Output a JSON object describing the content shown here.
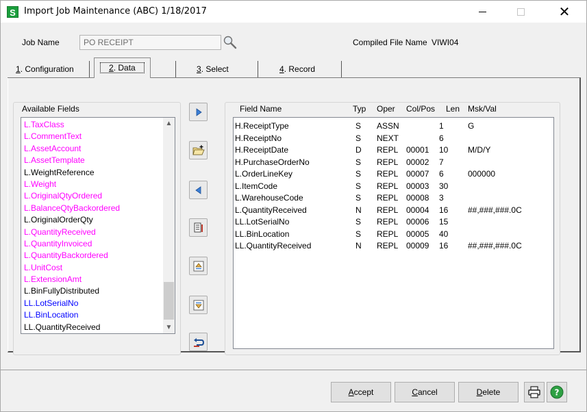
{
  "window": {
    "title": "Import Job Maintenance (ABC) 1/18/2017",
    "app_icon_letter": "S"
  },
  "header": {
    "job_name_label": "Job Name",
    "job_name_value": "PO RECEIPT",
    "compiled_label": "Compiled File Name",
    "compiled_value": "VIWI04"
  },
  "tabs": [
    {
      "num": "1",
      "label": ". Configuration"
    },
    {
      "num": "2",
      "label": ". Data"
    },
    {
      "num": "3",
      "label": ". Select"
    },
    {
      "num": "4",
      "label": ". Record"
    }
  ],
  "available_fields": {
    "title": "Available Fields",
    "items": [
      {
        "label": "L.TaxClass",
        "color": "#ff00ff"
      },
      {
        "label": "L.CommentText",
        "color": "#ff00ff"
      },
      {
        "label": "L.AssetAccount",
        "color": "#ff00ff"
      },
      {
        "label": "L.AssetTemplate",
        "color": "#ff00ff"
      },
      {
        "label": "L.WeightReference",
        "color": "#000000"
      },
      {
        "label": "L.Weight",
        "color": "#ff00ff"
      },
      {
        "label": "L.OriginalQtyOrdered",
        "color": "#ff00ff"
      },
      {
        "label": "L.BalanceQtyBackordered",
        "color": "#ff00ff"
      },
      {
        "label": "L.OriginalOrderQty",
        "color": "#000000"
      },
      {
        "label": "L.QuantityReceived",
        "color": "#ff00ff"
      },
      {
        "label": "L.QuantityInvoiced",
        "color": "#ff00ff"
      },
      {
        "label": "L.QuantityBackordered",
        "color": "#ff00ff"
      },
      {
        "label": "L.UnitCost",
        "color": "#ff00ff"
      },
      {
        "label": "L.ExtensionAmt",
        "color": "#ff00ff"
      },
      {
        "label": "L.BinFullyDistributed",
        "color": "#000000"
      },
      {
        "label": "LL.LotSerialNo",
        "color": "#0000ff"
      },
      {
        "label": "LL.BinLocation",
        "color": "#0000ff"
      },
      {
        "label": "LL.QuantityReceived",
        "color": "#000000"
      }
    ]
  },
  "field_table": {
    "headers": {
      "name": "Field Name",
      "typ": "Typ",
      "oper": "Oper",
      "colpos": "Col/Pos",
      "len": "Len",
      "msk": "Msk/Val"
    },
    "rows": [
      {
        "name": "H.ReceiptType",
        "typ": "S",
        "oper": "ASSN",
        "colpos": "",
        "len": "1",
        "msk": "G"
      },
      {
        "name": "H.ReceiptNo",
        "typ": "S",
        "oper": "NEXT",
        "colpos": "",
        "len": "6",
        "msk": ""
      },
      {
        "name": "H.ReceiptDate",
        "typ": "D",
        "oper": "REPL",
        "colpos": "00001",
        "len": "10",
        "msk": "M/D/Y"
      },
      {
        "name": "H.PurchaseOrderNo",
        "typ": "S",
        "oper": "REPL",
        "colpos": "00002",
        "len": "7",
        "msk": ""
      },
      {
        "name": "L.OrderLineKey",
        "typ": "S",
        "oper": "REPL",
        "colpos": "00007",
        "len": "6",
        "msk": "000000"
      },
      {
        "name": "L.ItemCode",
        "typ": "S",
        "oper": "REPL",
        "colpos": "00003",
        "len": "30",
        "msk": ""
      },
      {
        "name": "L.WarehouseCode",
        "typ": "S",
        "oper": "REPL",
        "colpos": "00008",
        "len": "3",
        "msk": ""
      },
      {
        "name": "L.QuantityReceived",
        "typ": "N",
        "oper": "REPL",
        "colpos": "00004",
        "len": "16",
        "msk": "##,###,###.0C"
      },
      {
        "name": "LL.LotSerialNo",
        "typ": "S",
        "oper": "REPL",
        "colpos": "00006",
        "len": "15",
        "msk": ""
      },
      {
        "name": "LL.BinLocation",
        "typ": "S",
        "oper": "REPL",
        "colpos": "00005",
        "len": "40",
        "msk": ""
      },
      {
        "name": "LL.QuantityReceived",
        "typ": "N",
        "oper": "REPL",
        "colpos": "00009",
        "len": "16",
        "msk": "##,###,###.0C"
      }
    ]
  },
  "buttons": {
    "accept": {
      "mn": "A",
      "rest": "ccept"
    },
    "cancel": {
      "mn": "C",
      "rest": "ancel"
    },
    "delete": {
      "mn": "D",
      "rest": "elete"
    }
  },
  "colors": {
    "magenta_field": "#ff00ff",
    "blue_field": "#0000ff",
    "app_green": "#1a9e3c"
  }
}
